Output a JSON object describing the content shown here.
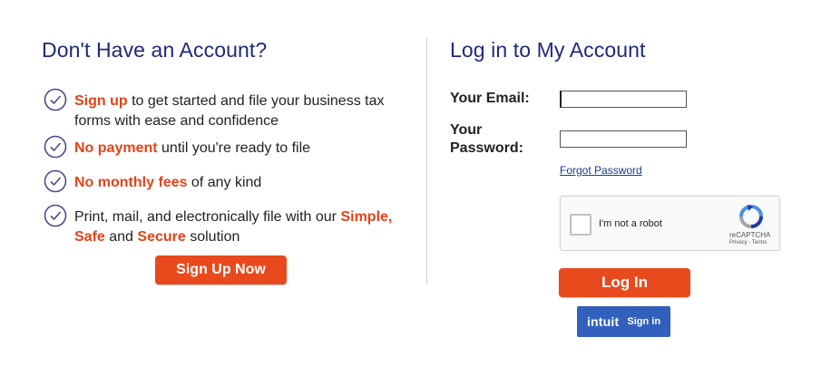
{
  "signup_panel": {
    "title": "Don't Have an Account?",
    "features": [
      {
        "em1": "Sign up",
        "t1": " to get started and file your business tax forms with ease and confidence"
      },
      {
        "em1": "No payment",
        "t1": " until you're ready to file"
      },
      {
        "em1": "No monthly fees",
        "t1": " of any kind"
      },
      {
        "t0": "Print, mail, and electronically file with our ",
        "em1": "Simple, Safe",
        "t1": " and ",
        "em2": "Secure",
        "t2": " solution"
      }
    ],
    "signup_button": "Sign Up Now"
  },
  "login_panel": {
    "title": "Log in to My Account",
    "email_label": "Your Email:",
    "email_value": "",
    "password_label_1": "Your",
    "password_label_2": "Password:",
    "password_value": "",
    "forgot_password": "Forgot Password",
    "recaptcha": {
      "label": "I'm not a robot",
      "brand": "reCAPTCHA",
      "terms": "Privacy - Terms"
    },
    "login_button": "Log In",
    "intuit": {
      "logo_text": "intuit",
      "sign_in": "Sign in"
    }
  },
  "colors": {
    "heading": "#1f2a78",
    "accent": "#e84a1d",
    "intuit_blue": "#3260bd"
  },
  "icons": {
    "feature_bullet": "check-circle-icon",
    "captcha_logo": "recaptcha-icon"
  }
}
